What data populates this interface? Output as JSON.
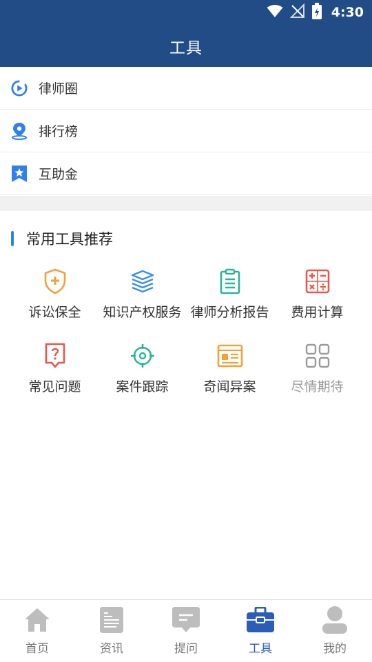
{
  "status_bar": {
    "time": "4:30"
  },
  "header": {
    "title": "工具"
  },
  "menu": [
    {
      "label": "律师圈",
      "icon": "play-circle-icon"
    },
    {
      "label": "排行榜",
      "icon": "location-pin-icon"
    },
    {
      "label": "互助金",
      "icon": "bookmark-star-icon"
    }
  ],
  "section": {
    "title": "常用工具推荐"
  },
  "tools": [
    {
      "label": "诉讼保全",
      "icon": "shield-plus-icon",
      "color": "#f0a236"
    },
    {
      "label": "知识产权服务",
      "icon": "stacked-books-icon",
      "color": "#3a8ee6"
    },
    {
      "label": "律师分析报告",
      "icon": "clipboard-icon",
      "color": "#2bb39a"
    },
    {
      "label": "费用计算",
      "icon": "calculator-icon",
      "color": "#e5584b"
    },
    {
      "label": "常见问题",
      "icon": "question-doc-icon",
      "color": "#e5584b"
    },
    {
      "label": "案件跟踪",
      "icon": "target-icon",
      "color": "#2bb39a"
    },
    {
      "label": "奇闻异案",
      "icon": "newspaper-icon",
      "color": "#f0a236"
    },
    {
      "label": "尽情期待",
      "icon": "grid-icon",
      "color": "#9a9a9a"
    }
  ],
  "tabs": [
    {
      "label": "首页",
      "icon": "home-icon",
      "active": false
    },
    {
      "label": "资讯",
      "icon": "document-icon",
      "active": false
    },
    {
      "label": "提问",
      "icon": "message-icon",
      "active": false
    },
    {
      "label": "工具",
      "icon": "toolbox-icon",
      "active": true
    },
    {
      "label": "我的",
      "icon": "user-icon",
      "active": false
    }
  ],
  "colors": {
    "header_bg": "#214c85",
    "accent": "#2f80ed",
    "tab_active": "#2b5db8",
    "tab_inactive": "#bdbdbd"
  }
}
